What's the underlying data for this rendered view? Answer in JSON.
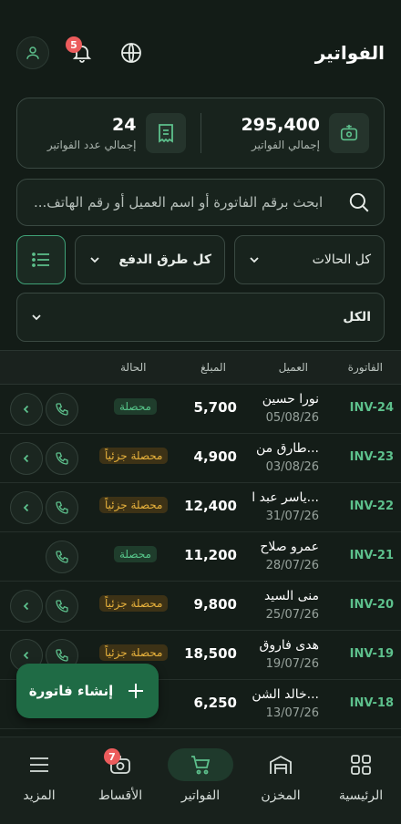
{
  "header": {
    "title": "الفواتير",
    "notification_count": "5"
  },
  "stats": {
    "total_invoices_value": "295,400",
    "total_invoices_label": "إجمالي الفواتير",
    "invoice_count_value": "24",
    "invoice_count_label": "إجمالي عدد الفواتير"
  },
  "search": {
    "placeholder": "ابحث برقم الفاتورة أو اسم العميل أو رقم الهاتف..."
  },
  "filters": {
    "status_label": "كل الحالات",
    "payment_label": "كل طرق الدفع",
    "period_label": "الكل"
  },
  "table": {
    "headers": {
      "invoice": "الفاتورة",
      "client": "العميل",
      "amount": "المبلغ",
      "status": "الحالة"
    },
    "rows": [
      {
        "invoice": "INV-24",
        "client": "نورا حسين",
        "date": "05/08/26",
        "amount": "5,700",
        "status": "محصلة",
        "status_type": "paid"
      },
      {
        "invoice": "INV-23",
        "client": "طارق من...",
        "date": "03/08/26",
        "amount": "4,900",
        "status": "محصلة جزئياً",
        "status_type": "partial"
      },
      {
        "invoice": "INV-22",
        "client": "ياسر عبد ا...",
        "date": "31/07/26",
        "amount": "12,400",
        "status": "محصلة جزئياً",
        "status_type": "partial"
      },
      {
        "invoice": "INV-21",
        "client": "عمرو صلاح",
        "date": "28/07/26",
        "amount": "11,200",
        "status": "محصلة",
        "status_type": "paid"
      },
      {
        "invoice": "INV-20",
        "client": "منى السيد",
        "date": "25/07/26",
        "amount": "9,800",
        "status": "محصلة جزئياً",
        "status_type": "partial"
      },
      {
        "invoice": "INV-19",
        "client": "هدى فاروق",
        "date": "19/07/26",
        "amount": "18,500",
        "status": "محصلة جزئياً",
        "status_type": "partial"
      },
      {
        "invoice": "INV-18",
        "client": "خالد الشن...",
        "date": "13/07/26",
        "amount": "6,250",
        "status": "",
        "status_type": "hidden"
      }
    ]
  },
  "fab": {
    "label": "إنشاء فاتورة"
  },
  "nav": {
    "home": "الرئيسية",
    "warehouse": "المخزن",
    "invoices": "الفواتير",
    "installments": "الأقساط",
    "installments_badge": "7",
    "more": "المزيد"
  },
  "colors": {
    "accent": "#5dc08c",
    "paid": "#56c489",
    "partial": "#e8b23c",
    "badge": "#ec5c5c"
  }
}
